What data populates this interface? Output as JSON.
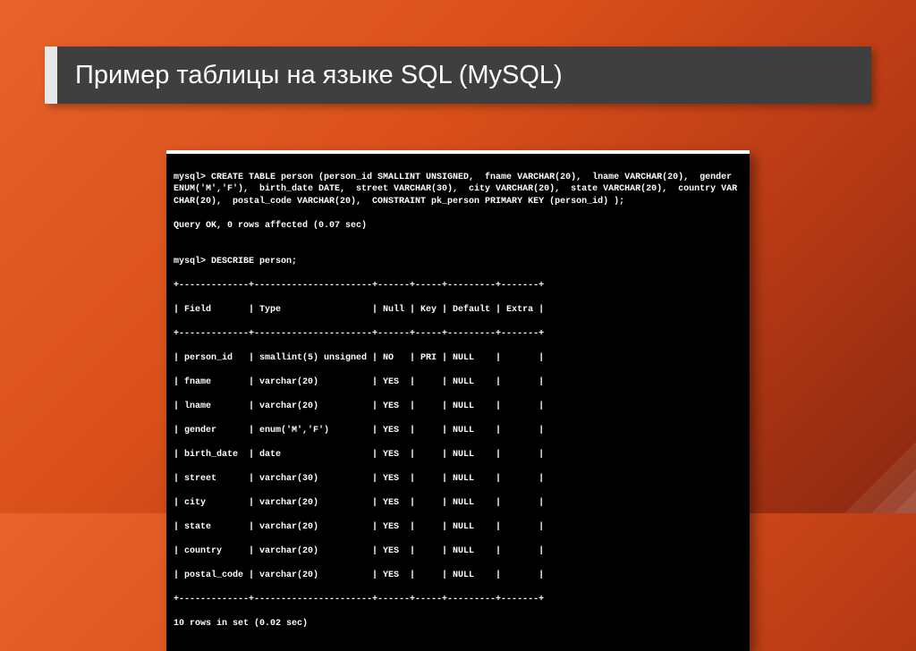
{
  "slide": {
    "title": "Пример таблицы на языке SQL (MySQL)"
  },
  "terminal": {
    "create_line": "mysql> CREATE TABLE person (person_id SMALLINT UNSIGNED,  fname VARCHAR(20),  lname VARCHAR(20),  gender ENUM('M','F'),  birth_date DATE,  street VARCHAR(30),  city VARCHAR(20),  state VARCHAR(20),  country VARCHAR(20),  postal_code VARCHAR(20),  CONSTRAINT pk_person PRIMARY KEY (person_id) );",
    "query_ok": "Query OK, 0 rows affected (0.07 sec)",
    "blank1": "",
    "describe_cmd": "mysql> DESCRIBE person;",
    "border": "+-------------+----------------------+------+-----+---------+-------+",
    "header": "| Field       | Type                 | Null | Key | Default | Extra |",
    "rows": [
      "| person_id   | smallint(5) unsigned | NO   | PRI | NULL    |       |",
      "| fname       | varchar(20)          | YES  |     | NULL    |       |",
      "| lname       | varchar(20)          | YES  |     | NULL    |       |",
      "| gender      | enum('M','F')        | YES  |     | NULL    |       |",
      "| birth_date  | date                 | YES  |     | NULL    |       |",
      "| street      | varchar(30)          | YES  |     | NULL    |       |",
      "| city        | varchar(20)          | YES  |     | NULL    |       |",
      "| state       | varchar(20)          | YES  |     | NULL    |       |",
      "| country     | varchar(20)          | YES  |     | NULL    |       |",
      "| postal_code | varchar(20)          | YES  |     | NULL    |       |"
    ],
    "footer": "10 rows in set (0.02 sec)"
  }
}
